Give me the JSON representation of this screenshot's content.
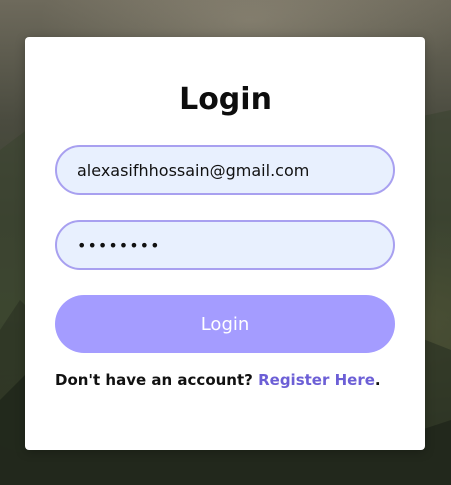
{
  "colors": {
    "accent": "#a49cff",
    "link": "#6c5fd6",
    "field_border": "#a8a0f0",
    "field_fill": "#e8f0fe",
    "card": "#ffffff"
  },
  "login": {
    "title": "Login",
    "email": {
      "value": "alexasifhhossain@gmail.com"
    },
    "password": {
      "value": "••••••••"
    },
    "submit_label": "Login",
    "footer": {
      "prompt": "Don't have an account?",
      "register_label": "Register Here",
      "trailing": "."
    }
  },
  "icons": {
    "background": "mountain-landscape-image"
  }
}
